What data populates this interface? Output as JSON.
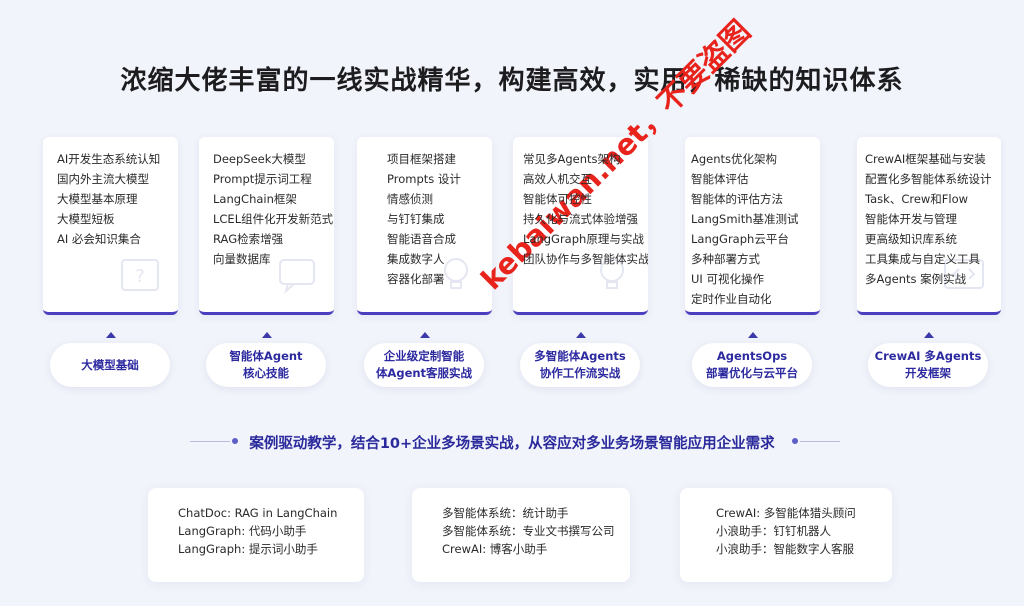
{
  "title": "浓缩大佬丰富的一线实战精华，构建高效，实用，稀缺的知识体系",
  "columns": [
    {
      "items": [
        "AI开发生态系统认知",
        "国内外主流大模型",
        "大模型基本原理",
        "大模型短板",
        "AI 必会知识集合"
      ],
      "label_line1": "大模型基础",
      "label_line2": ""
    },
    {
      "items": [
        "DeepSeek大模型",
        "Prompt提示词工程",
        "LangChain框架",
        "LCEL组件化开发新范式",
        "RAG检索增强",
        "向量数据库"
      ],
      "label_line1": "智能体Agent",
      "label_line2": "核心技能"
    },
    {
      "items": [
        "项目框架搭建",
        "Prompts 设计",
        "情感侦测",
        "与钉钉集成",
        "智能语音合成",
        "集成数字人",
        "容器化部署"
      ],
      "label_line1": "企业级定制智能",
      "label_line2": "体Agent客服实战"
    },
    {
      "items": [
        "常见多Agents架构",
        "高效人机交互",
        "智能体可控性",
        "持久化与流式体验增强",
        "LangGraph原理与实战",
        "团队协作与多智能体实战"
      ],
      "label_line1": "多智能体Agents",
      "label_line2": "协作工作流实战"
    },
    {
      "items": [
        "Agents优化架构",
        "智能体评估",
        "智能体的评估方法",
        "LangSmith基准测试",
        "LangGraph云平台",
        "多种部署方式",
        "UI 可视化操作",
        "定时作业自动化"
      ],
      "label_line1": "AgentsOps",
      "label_line2": "部署优化与云平台"
    },
    {
      "items": [
        "CrewAI框架基础与安装",
        "配置化多智能体系统设计",
        "Task、Crew和Flow",
        "智能体开发与管理",
        "更高级知识库系统",
        "工具集成与自定义工具",
        "多Agents 案例实战"
      ],
      "label_line1": "CrewAI 多Agents",
      "label_line2": "开发框架"
    }
  ],
  "tagline": "案例驱动教学，结合10+企业多场景实战，从容应对多业务场景智能应用企业需求",
  "cases": [
    [
      "ChatDoc: RAG in LangChain",
      "LangGraph: 代码小助手",
      "LangGraph: 提示词小助手"
    ],
    [
      "多智能体系统：统计助手",
      "多智能体系统：专业文书撰写公司",
      "CrewAI: 博客小助手"
    ],
    [
      "CrewAI: 多智能体猎头顾问",
      "小浪助手：钉钉机器人",
      "小浪助手：智能数字人客服"
    ]
  ],
  "watermark": "kebaiwan.net，不要盗图",
  "colors": {
    "accent": "#2d2aa0",
    "background": "#f2f4fb",
    "watermark": "#e8231c"
  }
}
